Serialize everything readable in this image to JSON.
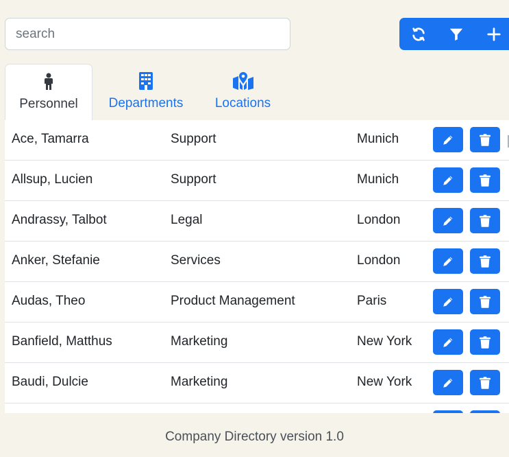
{
  "search": {
    "placeholder": "search",
    "value": ""
  },
  "toolbar": {
    "buttons": [
      {
        "icon": "refresh-icon"
      },
      {
        "icon": "filter-icon"
      },
      {
        "icon": "plus-icon"
      }
    ]
  },
  "tabs": [
    {
      "label": "Personnel",
      "icon": "person-icon",
      "active": true
    },
    {
      "label": "Departments",
      "icon": "building-icon",
      "active": false
    },
    {
      "label": "Locations",
      "icon": "map-location-icon",
      "active": false
    }
  ],
  "personnel": [
    {
      "name": "Ace, Tamarra",
      "department": "Support",
      "location": "Munich"
    },
    {
      "name": "Allsup, Lucien",
      "department": "Support",
      "location": "Munich"
    },
    {
      "name": "Andrassy, Talbot",
      "department": "Legal",
      "location": "London"
    },
    {
      "name": "Anker, Stefanie",
      "department": "Services",
      "location": "London"
    },
    {
      "name": "Audas, Theo",
      "department": "Product Management",
      "location": "Paris"
    },
    {
      "name": "Banfield, Matthus",
      "department": "Marketing",
      "location": "New York"
    },
    {
      "name": "Baudi, Dulcie",
      "department": "Marketing",
      "location": "New York"
    }
  ],
  "footer": {
    "text": "Company Directory version 1.0"
  },
  "colors": {
    "accent": "#1a73f0",
    "background": "#f6f3eb",
    "table_bg": "#ffffff",
    "text": "#212529"
  }
}
